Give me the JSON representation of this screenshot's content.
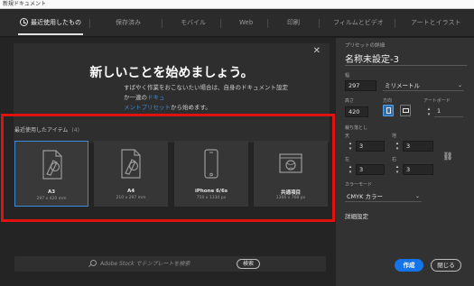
{
  "window": {
    "title": "新規ドキュメント"
  },
  "tabs": [
    {
      "label": "最近使用したもの",
      "active": true
    },
    {
      "label": "保存済み"
    },
    {
      "label": "モバイル"
    },
    {
      "label": "Web"
    },
    {
      "label": "印刷"
    },
    {
      "label": "フィルムとビデオ"
    },
    {
      "label": "アートとイラスト"
    }
  ],
  "hero": {
    "title": "新しいことを始めましょう。",
    "text_before": "すばやく作業をおこないたい場合は、自身のドキュメント設定か一連の",
    "link_1": "ドキュ",
    "link_2": "メントプリセット",
    "text_after": "から始めます。"
  },
  "recent": {
    "label": "最近使用したアイテム",
    "count": "(4)",
    "items": [
      {
        "name": "A3",
        "size": "297 x 420 mm",
        "icon": "document-edit-icon",
        "selected": true
      },
      {
        "name": "A4",
        "size": "210 x 297 mm",
        "icon": "document-edit-icon"
      },
      {
        "name": "iPhone 6/6s",
        "size": "750 x 1334 px",
        "icon": "phone-icon"
      },
      {
        "name": "共通項目",
        "size": "1366 x 768 px",
        "icon": "web-browser-icon"
      }
    ]
  },
  "search": {
    "placeholder": "Adobe Stock でテンプレートを検索",
    "button": "検索"
  },
  "preset": {
    "section_title": "プリセットの詳細",
    "name": "名称未設定-3",
    "width_label": "幅",
    "width_value": "297",
    "unit": "ミリメートル",
    "height_label": "高さ",
    "height_value": "420",
    "orientation_label": "方向",
    "orientation": "portrait",
    "artboard_label": "アートボード",
    "artboard_value": "1",
    "bleed_label": "裁ち落とし",
    "bleed_top_label": "天",
    "bleed_top": "3",
    "bleed_bottom_label": "地",
    "bleed_bottom": "3",
    "bleed_left_label": "左",
    "bleed_left": "3",
    "bleed_right_label": "右",
    "bleed_right": "3",
    "color_mode_label": "カラーモード",
    "color_mode": "CMYK カラー",
    "advanced": "詳細設定"
  },
  "buttons": {
    "create": "作成",
    "close": "閉じる"
  },
  "colors": {
    "accent": "#1473e6",
    "highlight_border": "#e0120f",
    "selected_card": "#3d8bd8"
  }
}
